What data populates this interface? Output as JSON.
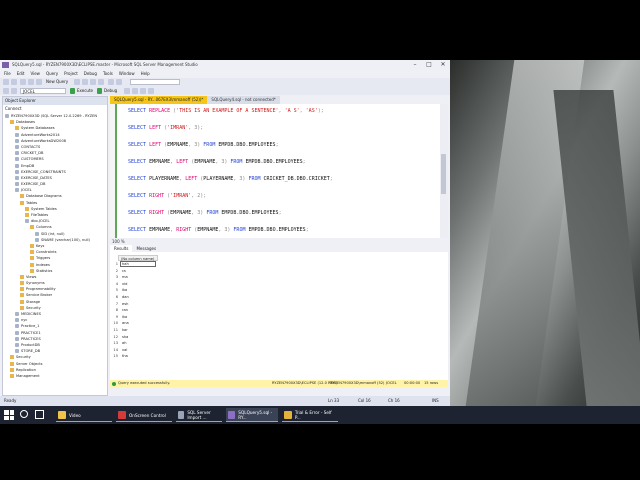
{
  "window": {
    "title": "SQLQuery5.sql - RYZEN7900X3D\\ECLIPSE.master - Microsoft SQL Server Management Studio"
  },
  "menu": [
    "File",
    "Edit",
    "View",
    "Query",
    "Project",
    "Debug",
    "Tools",
    "Window",
    "Help"
  ],
  "toolbar": {
    "new_query": "New Query",
    "execute": "Execute",
    "debug": "Debug",
    "database": "JOCEL"
  },
  "object_explorer": {
    "title": "Object Explorer",
    "connect": "Connect",
    "nodes": [
      {
        "label": "RYZEN7900X3D (SQL Server 12.0.2269 - RYZEN",
        "indent": 0,
        "icon": "server-icon"
      },
      {
        "label": "Databases",
        "indent": 1,
        "icon": "folder-icon"
      },
      {
        "label": "System Databases",
        "indent": 2,
        "icon": "folder-icon"
      },
      {
        "label": "AdventureWorks2014",
        "indent": 2,
        "icon": "database-icon"
      },
      {
        "label": "AdventureWorksDW2008",
        "indent": 2,
        "icon": "database-icon"
      },
      {
        "label": "CONTACTS",
        "indent": 2,
        "icon": "database-icon"
      },
      {
        "label": "CRICKET_DB",
        "indent": 2,
        "icon": "database-icon"
      },
      {
        "label": "CUSTOMERS",
        "indent": 2,
        "icon": "database-icon"
      },
      {
        "label": "EmpDB",
        "indent": 2,
        "icon": "database-icon"
      },
      {
        "label": "EXERCISE_CONSTRAINTS",
        "indent": 2,
        "icon": "database-icon"
      },
      {
        "label": "EXERCISE_DATES",
        "indent": 2,
        "icon": "database-icon"
      },
      {
        "label": "EXERCISE_DB",
        "indent": 2,
        "icon": "database-icon"
      },
      {
        "label": "JOCEL",
        "indent": 2,
        "icon": "database-icon"
      },
      {
        "label": "Database Diagrams",
        "indent": 3,
        "icon": "folder-icon"
      },
      {
        "label": "Tables",
        "indent": 3,
        "icon": "folder-icon"
      },
      {
        "label": "System Tables",
        "indent": 4,
        "icon": "folder-icon"
      },
      {
        "label": "FileTables",
        "indent": 4,
        "icon": "folder-icon"
      },
      {
        "label": "dbo.JOCEL",
        "indent": 4,
        "icon": "table-icon"
      },
      {
        "label": "Columns",
        "indent": 5,
        "icon": "folder-icon"
      },
      {
        "label": "SID (int, null)",
        "indent": 6,
        "icon": "column-icon"
      },
      {
        "label": "SNAME (varchar(100), null)",
        "indent": 6,
        "icon": "column-icon"
      },
      {
        "label": "Keys",
        "indent": 5,
        "icon": "folder-icon"
      },
      {
        "label": "Constraints",
        "indent": 5,
        "icon": "folder-icon"
      },
      {
        "label": "Triggers",
        "indent": 5,
        "icon": "folder-icon"
      },
      {
        "label": "Indexes",
        "indent": 5,
        "icon": "folder-icon"
      },
      {
        "label": "Statistics",
        "indent": 5,
        "icon": "folder-icon"
      },
      {
        "label": "Views",
        "indent": 3,
        "icon": "folder-icon"
      },
      {
        "label": "Synonyms",
        "indent": 3,
        "icon": "folder-icon"
      },
      {
        "label": "Programmability",
        "indent": 3,
        "icon": "folder-icon"
      },
      {
        "label": "Service Broker",
        "indent": 3,
        "icon": "folder-icon"
      },
      {
        "label": "Storage",
        "indent": 3,
        "icon": "folder-icon"
      },
      {
        "label": "Security",
        "indent": 3,
        "icon": "folder-icon"
      },
      {
        "label": "MEDICINES",
        "indent": 2,
        "icon": "database-icon"
      },
      {
        "label": "nyc",
        "indent": 2,
        "icon": "database-icon"
      },
      {
        "label": "Practice_1",
        "indent": 2,
        "icon": "database-icon"
      },
      {
        "label": "PRACTICE1",
        "indent": 2,
        "icon": "database-icon"
      },
      {
        "label": "PRACTICES",
        "indent": 2,
        "icon": "database-icon"
      },
      {
        "label": "ProductDB",
        "indent": 2,
        "icon": "database-icon"
      },
      {
        "label": "STORE_DB",
        "indent": 2,
        "icon": "database-icon"
      },
      {
        "label": "Security",
        "indent": 1,
        "icon": "folder-icon"
      },
      {
        "label": "Server Objects",
        "indent": 1,
        "icon": "folder-icon"
      },
      {
        "label": "Replication",
        "indent": 1,
        "icon": "folder-icon"
      },
      {
        "label": "Management",
        "indent": 1,
        "icon": "folder-icon"
      }
    ]
  },
  "tabs": [
    {
      "label": "SQLQuery5.sql - RY...067EX3\\mmanoff (52))*",
      "active": true
    },
    {
      "label": "SQLQuery4.sql - not connected*",
      "active": false
    }
  ],
  "code": [
    {
      "parts": [
        [
          "kw",
          "SELECT "
        ],
        [
          "fn",
          "REPLACE"
        ],
        [
          "gr",
          " ("
        ],
        [
          "str",
          "'THIS IS AN EXAMPLE OF A SENTENCE'"
        ],
        [
          "gr",
          ", "
        ],
        [
          "str",
          "'A S'"
        ],
        [
          "gr",
          ", "
        ],
        [
          "str",
          "'AS'"
        ],
        [
          "gr",
          ");"
        ]
      ]
    },
    {
      "parts": [
        [
          "kw",
          "SELECT "
        ],
        [
          "fn",
          "LEFT"
        ],
        [
          "gr",
          " ("
        ],
        [
          "str",
          "'IMRAN'"
        ],
        [
          "gr",
          ", 3);"
        ]
      ]
    },
    {
      "parts": [
        [
          "kw",
          "SELECT "
        ],
        [
          "fn",
          "LEFT"
        ],
        [
          "gr",
          " ("
        ],
        [
          "tx",
          "EMPNAME"
        ],
        [
          "gr",
          ", 3) "
        ],
        [
          "kw",
          "FROM "
        ],
        [
          "tx",
          "EMPDB.DBO.EMPLOYEES"
        ],
        [
          "gr",
          ";"
        ]
      ]
    },
    {
      "parts": [
        [
          "kw",
          "SELECT "
        ],
        [
          "tx",
          "EMPNAME"
        ],
        [
          "gr",
          ", "
        ],
        [
          "fn",
          "LEFT"
        ],
        [
          "gr",
          " ("
        ],
        [
          "tx",
          "EMPNAME"
        ],
        [
          "gr",
          ", 3) "
        ],
        [
          "kw",
          "FROM "
        ],
        [
          "tx",
          "EMPDB.DBO.EMPLOYEES"
        ],
        [
          "gr",
          ";"
        ]
      ]
    },
    {
      "parts": [
        [
          "kw",
          "SELECT "
        ],
        [
          "tx",
          "PLAYERNAME"
        ],
        [
          "gr",
          ", "
        ],
        [
          "fn",
          "LEFT"
        ],
        [
          "gr",
          " ("
        ],
        [
          "tx",
          "PLAYERNAME"
        ],
        [
          "gr",
          ", 3) "
        ],
        [
          "kw",
          "FROM "
        ],
        [
          "tx",
          "CRICKET_DB.DBO.CRICKET"
        ],
        [
          "gr",
          ";"
        ]
      ]
    },
    {
      "parts": [
        [
          "kw",
          "SELECT "
        ],
        [
          "fn",
          "RIGHT"
        ],
        [
          "gr",
          " ("
        ],
        [
          "str",
          "'IMRAN'"
        ],
        [
          "gr",
          ", 2);"
        ]
      ]
    },
    {
      "parts": [
        [
          "kw",
          "SELECT "
        ],
        [
          "fn",
          "RIGHT"
        ],
        [
          "gr",
          " ("
        ],
        [
          "tx",
          "EMPNAME"
        ],
        [
          "gr",
          ", 3) "
        ],
        [
          "kw",
          "FROM "
        ],
        [
          "tx",
          "EMPDB.DBO.EMPLOYEES"
        ],
        [
          "gr",
          ";"
        ]
      ]
    },
    {
      "parts": [
        [
          "kw",
          "SELECT "
        ],
        [
          "tx",
          "EMPNAME"
        ],
        [
          "gr",
          ", "
        ],
        [
          "fn",
          "RIGHT"
        ],
        [
          "gr",
          " ("
        ],
        [
          "tx",
          "EMPNAME"
        ],
        [
          "gr",
          ", 3) "
        ],
        [
          "kw",
          "FROM "
        ],
        [
          "tx",
          "EMPDB.DBO.EMPLOYEES"
        ],
        [
          "gr",
          ";"
        ]
      ]
    }
  ],
  "zoom": "100 %",
  "result_tabs": [
    "Results",
    "Messages"
  ],
  "results": {
    "header": "(No column name)",
    "rows": [
      "hah",
      "ra",
      "ma",
      "vid",
      "ika",
      "dan",
      "esh",
      "ran",
      "ika",
      "ana",
      "kar",
      "sha",
      "ah",
      "val",
      "tha"
    ]
  },
  "query_status": {
    "message": "Query executed successfully.",
    "server": "RYZEN7900X3D\\ECLIPSE (12.0 RTM)",
    "user": "RYZEN7900X3D\\mmanoff (52)",
    "db": "JOCEL",
    "time": "00:00:00",
    "rows": "15 rows"
  },
  "app_status": {
    "ready": "Ready",
    "ln": "Ln 33",
    "col": "Col 16",
    "ch": "Ch 16",
    "ins": "INS"
  },
  "taskbar": [
    {
      "label": "Video",
      "icon": "folder-icon",
      "color": "#f0c24a",
      "active": false
    },
    {
      "label": "OnScreen Control",
      "icon": "onscreen-icon",
      "color": "#d33b3b",
      "active": false
    },
    {
      "label": "SQL Server Import ...",
      "icon": "sql-import-icon",
      "color": "#9aa4b8",
      "active": false
    },
    {
      "label": "SQLQuery5.sql - RY...",
      "icon": "ssms-icon",
      "color": "#8c6fc2",
      "active": true
    },
    {
      "label": "Trial & Error - Self P...",
      "icon": "chrome-icon",
      "color": "#e4b33a",
      "active": false
    }
  ],
  "colors": {
    "keyword": "#1f3fd4",
    "function": "#e0006e",
    "string": "#d01818",
    "tab_active": "#f5c518",
    "status_ok": "#fff3a8"
  }
}
